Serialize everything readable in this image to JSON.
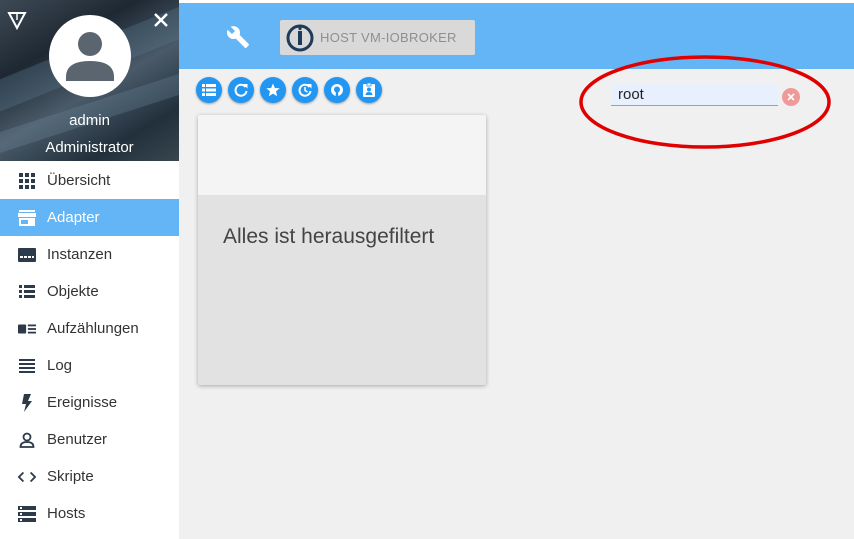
{
  "sidebar": {
    "user": {
      "name": "admin",
      "role": "Administrator"
    },
    "items": [
      {
        "label": "Übersicht",
        "icon": "apps-grid-icon",
        "active": false
      },
      {
        "label": "Adapter",
        "icon": "store-icon",
        "active": true
      },
      {
        "label": "Instanzen",
        "icon": "instances-icon",
        "active": false
      },
      {
        "label": "Objekte",
        "icon": "list-icon",
        "active": false
      },
      {
        "label": "Aufzählungen",
        "icon": "enum-icon",
        "active": false
      },
      {
        "label": "Log",
        "icon": "log-lines-icon",
        "active": false
      },
      {
        "label": "Ereignisse",
        "icon": "flash-icon",
        "active": false
      },
      {
        "label": "Benutzer",
        "icon": "person-icon",
        "active": false
      },
      {
        "label": "Skripte",
        "icon": "code-icon",
        "active": false
      },
      {
        "label": "Hosts",
        "icon": "server-icon",
        "active": false
      }
    ]
  },
  "header": {
    "host_label": "HOST VM-IOBROKER"
  },
  "toolbar": {
    "buttons": [
      "list-view-icon",
      "refresh-icon",
      "star-icon",
      "update-icon",
      "github-icon",
      "badge-icon"
    ]
  },
  "search": {
    "value": "root"
  },
  "card": {
    "message": "Alles ist herausgefiltert"
  },
  "colors": {
    "header": "#64b5f6",
    "active_item": "#64b5f6",
    "toolbar_button": "#2196f3",
    "highlight": "#e00000",
    "clear_button": "#ef9a9a"
  }
}
